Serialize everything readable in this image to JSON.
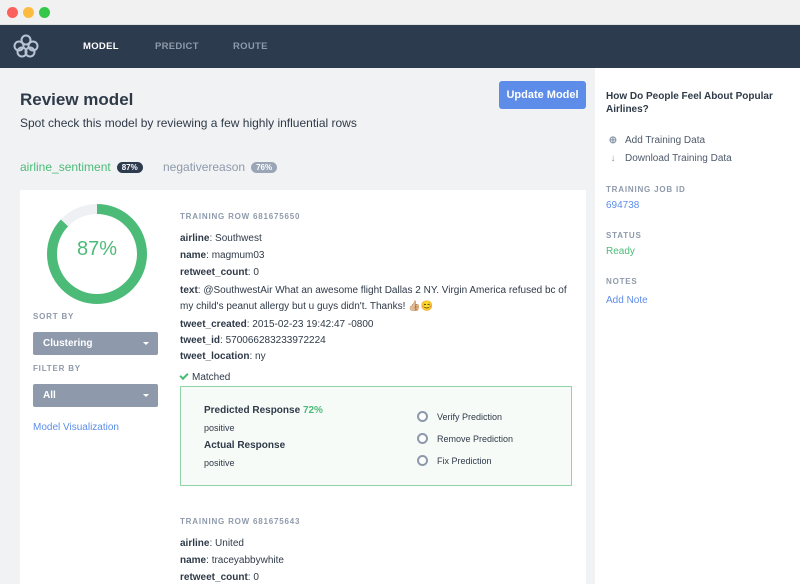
{
  "nav": {
    "items": [
      {
        "label": "MODEL",
        "active": true
      },
      {
        "label": "PREDICT",
        "active": false
      },
      {
        "label": "ROUTE",
        "active": false
      }
    ]
  },
  "page": {
    "title": "Review model",
    "subtitle": "Spot check this model by reviewing a few highly influential rows",
    "update_button": "Update Model"
  },
  "label_tabs": [
    {
      "name": "airline_sentiment",
      "pill": "87%"
    },
    {
      "name": "negativereason",
      "pill": "76%"
    }
  ],
  "accuracy": {
    "label": "87%",
    "fraction": 0.87
  },
  "controls": {
    "sort_by_label": "SORT BY",
    "sort_by_value": "Clustering",
    "filter_by_label": "FILTER BY",
    "filter_by_value": "All",
    "viz_link": "Model Visualization"
  },
  "rows": [
    {
      "heading": "TRAINING ROW 681675650",
      "fields": [
        {
          "key": "airline",
          "value": "Southwest"
        },
        {
          "key": "name",
          "value": "magmum03"
        },
        {
          "key": "retweet_count",
          "value": "0"
        },
        {
          "key": "text",
          "value": "@SouthwestAir What an awesome flight Dallas 2 NY. Virgin America refused bc of my child's peanut allergy but u guys didn't. Thanks! 👍🏼😊"
        },
        {
          "key": "tweet_created",
          "value": "2015-02-23 19:42:47 -0800"
        },
        {
          "key": "tweet_id",
          "value": "570066283233972224"
        },
        {
          "key": "tweet_location",
          "value": "ny"
        }
      ],
      "matched": "Matched",
      "predicted_label": "Predicted Response",
      "predicted_pct": "72%",
      "predicted_value": "positive",
      "actual_label": "Actual Response",
      "actual_value": "positive",
      "options": [
        "Verify Prediction",
        "Remove Prediction",
        "Fix Prediction"
      ]
    },
    {
      "heading": "TRAINING ROW 681675643",
      "fields": [
        {
          "key": "airline",
          "value": "United"
        },
        {
          "key": "name",
          "value": "traceyabbywhite"
        },
        {
          "key": "retweet_count",
          "value": "0"
        }
      ]
    }
  ],
  "sidebar": {
    "title": "How Do People Feel About Popular Airlines?",
    "links": [
      {
        "icon": "plus-circle-icon",
        "label": "Add Training Data"
      },
      {
        "icon": "download-arrow-icon",
        "label": "Download Training Data"
      }
    ],
    "job_id_label": "TRAINING JOB ID",
    "job_id": "694738",
    "status_label": "STATUS",
    "status": "Ready",
    "notes_label": "NOTES",
    "add_note": "Add Note"
  },
  "colors": {
    "nav_bg": "#2c3b4e",
    "accent_green": "#4cbb78",
    "accent_blue": "#5d8de8",
    "muted": "#8e9aab"
  }
}
